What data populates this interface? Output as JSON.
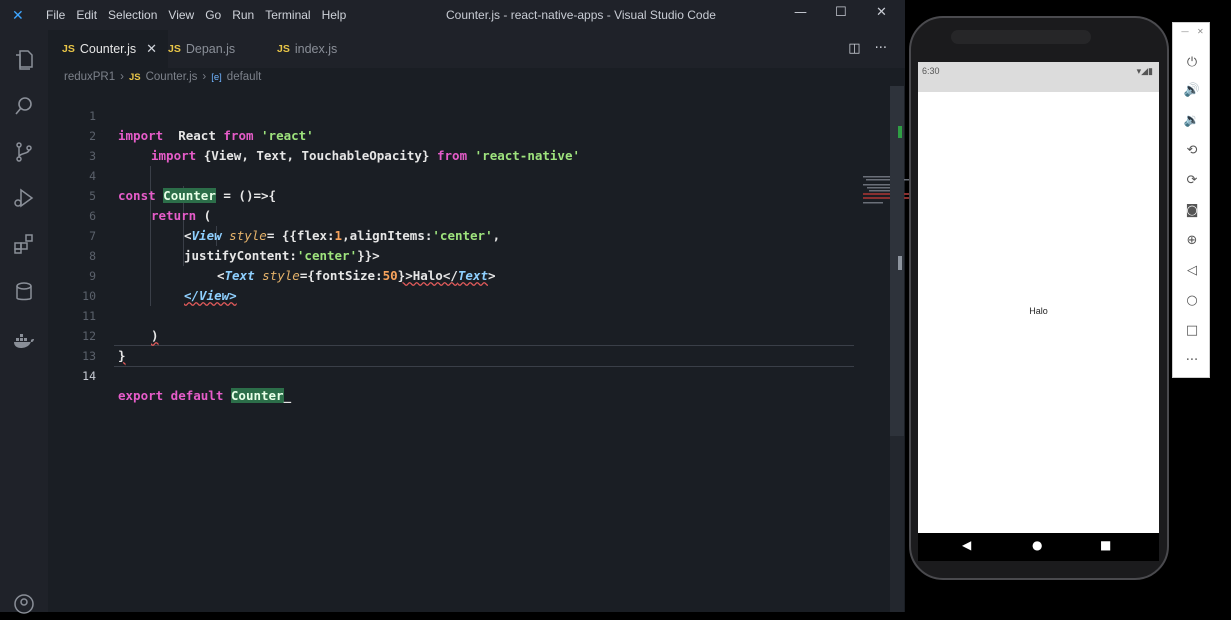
{
  "window": {
    "title": "Counter.js - react-native-apps - Visual Studio Code",
    "menu": [
      "File",
      "Edit",
      "Selection",
      "View",
      "Go",
      "Run",
      "Terminal",
      "Help"
    ]
  },
  "tabs": [
    {
      "label": "Counter.js",
      "active": true
    },
    {
      "label": "Depan.js",
      "active": false
    },
    {
      "label": "index.js",
      "active": false
    }
  ],
  "tab_badge": "JS",
  "breadcrumb": {
    "folder": "reduxPR1",
    "file": "Counter.js",
    "symbol": "default",
    "symbol_badge": "[e]"
  },
  "code": {
    "line_numbers": [
      "1",
      "2",
      "3",
      "4",
      "5",
      "6",
      "7",
      "8",
      "9",
      "10",
      "11",
      "12",
      "13",
      "14"
    ],
    "l1": {
      "kw": "import",
      "name": "React",
      "from": "from",
      "str": "'react'"
    },
    "l2": {
      "kw": "import",
      "names": "{View, Text, TouchableOpacity}",
      "from": "from",
      "str": "'react-native'"
    },
    "l4": {
      "kw": "const",
      "name": "Counter",
      "rest": " = ()=>{"
    },
    "l5": {
      "kw": "return",
      "rest": " ("
    },
    "l6": {
      "open": "<",
      "tag": "View",
      "attr": "style",
      "eq": "= {{flex:",
      "num": "1",
      "mid": ",alignItems:",
      "str": "'center'",
      "end": ","
    },
    "l7": {
      "prop": "justifyContent:",
      "str": "'center'",
      "end": "}}>"
    },
    "l8": {
      "open": "<",
      "tag": "Text",
      "attr": "style",
      "eq": "={fontSize:",
      "num": "50",
      "mid": "}>Halo</",
      "tag2": "Text",
      "end": ">"
    },
    "l9": {
      "text": "</View>"
    },
    "l11": {
      "text": ")"
    },
    "l12": {
      "text": "}"
    },
    "l14": {
      "kw": "export default",
      "name": "Counter"
    }
  },
  "phone": {
    "status_time": "6:30",
    "screen_text": "Halo"
  },
  "colors": {
    "accent": "#3ea6ff",
    "js_badge": "#e8c547",
    "highlight": "#2c6e49"
  }
}
